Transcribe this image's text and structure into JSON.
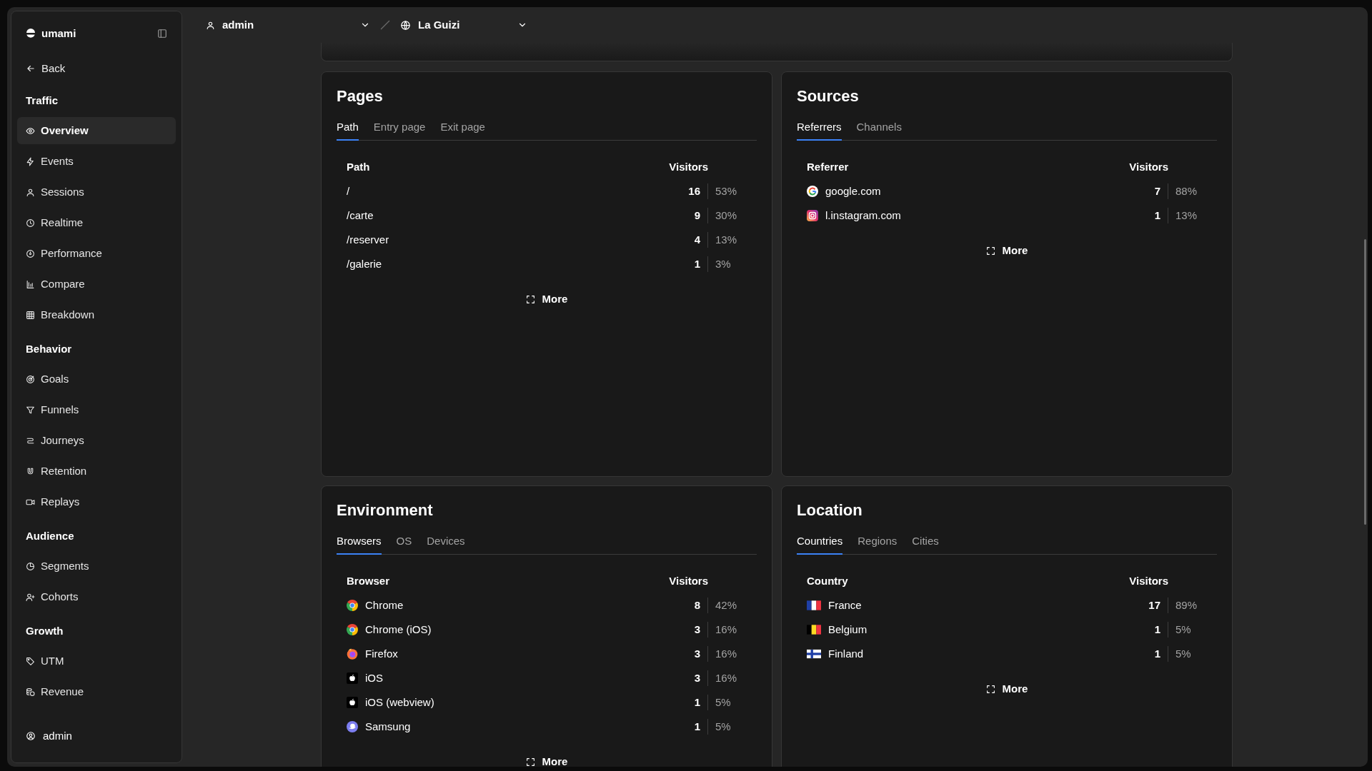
{
  "app": {
    "name": "umami"
  },
  "sidebar": {
    "back": "Back",
    "sections": [
      {
        "title": "Traffic",
        "items": [
          {
            "label": "Overview",
            "kind": "eye",
            "selected": true
          },
          {
            "label": "Events",
            "kind": "bolt",
            "selected": false
          },
          {
            "label": "Sessions",
            "kind": "user",
            "selected": false
          },
          {
            "label": "Realtime",
            "kind": "clock",
            "selected": false
          },
          {
            "label": "Performance",
            "kind": "gauge",
            "selected": false
          },
          {
            "label": "Compare",
            "kind": "bars",
            "selected": false
          },
          {
            "label": "Breakdown",
            "kind": "table",
            "selected": false
          }
        ]
      },
      {
        "title": "Behavior",
        "items": [
          {
            "label": "Goals",
            "kind": "target",
            "selected": false
          },
          {
            "label": "Funnels",
            "kind": "funnel",
            "selected": false
          },
          {
            "label": "Journeys",
            "kind": "route",
            "selected": false
          },
          {
            "label": "Retention",
            "kind": "magnet",
            "selected": false
          },
          {
            "label": "Replays",
            "kind": "video",
            "selected": false
          }
        ]
      },
      {
        "title": "Audience",
        "items": [
          {
            "label": "Segments",
            "kind": "pie",
            "selected": false
          },
          {
            "label": "Cohorts",
            "kind": "userplus",
            "selected": false
          }
        ]
      },
      {
        "title": "Growth",
        "items": [
          {
            "label": "UTM",
            "kind": "tag",
            "selected": false
          },
          {
            "label": "Revenue",
            "kind": "coins",
            "selected": false
          }
        ]
      }
    ],
    "user": "admin"
  },
  "header": {
    "user": "admin",
    "website": "La Guizi"
  },
  "cards": [
    {
      "title": "Pages",
      "tabs": [
        {
          "label": "Path",
          "selected": true
        },
        {
          "label": "Entry page",
          "selected": false
        },
        {
          "label": "Exit page",
          "selected": false
        }
      ],
      "columns": [
        "Path",
        "Visitors"
      ],
      "rows": [
        {
          "label": "/",
          "count": "16",
          "percent": "53%"
        },
        {
          "label": "/carte",
          "count": "9",
          "percent": "30%"
        },
        {
          "label": "/reserver",
          "count": "4",
          "percent": "13%"
        },
        {
          "label": "/galerie",
          "count": "1",
          "percent": "3%"
        }
      ],
      "more": "More"
    },
    {
      "title": "Sources",
      "tabs": [
        {
          "label": "Referrers",
          "selected": true
        },
        {
          "label": "Channels",
          "selected": false
        }
      ],
      "columns": [
        "Referrer",
        "Visitors"
      ],
      "rows": [
        {
          "label": "google.com",
          "kind": "google",
          "count": "7",
          "percent": "88%"
        },
        {
          "label": "l.instagram.com",
          "kind": "instagram",
          "count": "1",
          "percent": "13%"
        }
      ],
      "more": "More"
    },
    {
      "title": "Environment",
      "tabs": [
        {
          "label": "Browsers",
          "selected": true
        },
        {
          "label": "OS",
          "selected": false
        },
        {
          "label": "Devices",
          "selected": false
        }
      ],
      "columns": [
        "Browser",
        "Visitors"
      ],
      "rows": [
        {
          "label": "Chrome",
          "kind": "chrome",
          "count": "8",
          "percent": "42%"
        },
        {
          "label": "Chrome (iOS)",
          "kind": "chrome",
          "count": "3",
          "percent": "16%"
        },
        {
          "label": "Firefox",
          "kind": "firefox",
          "count": "3",
          "percent": "16%"
        },
        {
          "label": "iOS",
          "kind": "apple",
          "count": "3",
          "percent": "16%"
        },
        {
          "label": "iOS (webview)",
          "kind": "apple",
          "count": "1",
          "percent": "5%"
        },
        {
          "label": "Samsung",
          "kind": "samsung",
          "count": "1",
          "percent": "5%"
        }
      ],
      "more": "More"
    },
    {
      "title": "Location",
      "tabs": [
        {
          "label": "Countries",
          "selected": true
        },
        {
          "label": "Regions",
          "selected": false
        },
        {
          "label": "Cities",
          "selected": false
        }
      ],
      "columns": [
        "Country",
        "Visitors"
      ],
      "rows": [
        {
          "label": "France",
          "kind": "france",
          "count": "17",
          "percent": "89%"
        },
        {
          "label": "Belgium",
          "kind": "belgium",
          "count": "1",
          "percent": "5%"
        },
        {
          "label": "Finland",
          "kind": "finland",
          "count": "1",
          "percent": "5%"
        }
      ],
      "more": "More"
    }
  ]
}
